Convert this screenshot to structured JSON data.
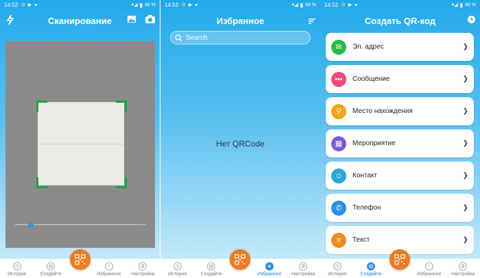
{
  "scan": {
    "status": {
      "time": "14:52",
      "battery": "46 %"
    },
    "title": "Сканирование",
    "icons": [
      "flash-icon",
      "gallery-icon",
      "camera-switch-icon"
    ]
  },
  "favorites": {
    "status": {
      "time": "14:53",
      "battery": "46 %"
    },
    "title": "Избранное",
    "search_placeholder": "Search",
    "empty_text": "Нет QRCode"
  },
  "create": {
    "status": {
      "time": "14:52",
      "battery": "46 %"
    },
    "title": "Создать QR-код",
    "items": [
      {
        "label": "Эл. адрес",
        "icon": "email-icon",
        "color": "#2dbb48",
        "glyph": "✉"
      },
      {
        "label": "Сообщение",
        "icon": "message-icon",
        "color": "#ee4c73",
        "glyph": "•••"
      },
      {
        "label": "Место нахождения",
        "icon": "location-icon",
        "color": "#f4a41b",
        "glyph": "⚲"
      },
      {
        "label": "Мероприятие",
        "icon": "calendar-icon",
        "color": "#7d5bd7",
        "glyph": "▦"
      },
      {
        "label": "Контакт",
        "icon": "contact-icon",
        "color": "#2aa9d8",
        "glyph": "☺"
      },
      {
        "label": "Телефон",
        "icon": "phone-icon",
        "color": "#2a8fe6",
        "glyph": "✆"
      },
      {
        "label": "Текст",
        "icon": "text-icon",
        "color": "#f08a1c",
        "glyph": "≡"
      }
    ]
  },
  "nav": {
    "history": "История",
    "create": "Создайте",
    "create_alt": "Создайте",
    "favorites": "Избранное",
    "settings": "Настройки"
  },
  "colors": {
    "accent": "#22a9ea",
    "scan_button": "#f07a1c",
    "frame": "#21a33a"
  }
}
